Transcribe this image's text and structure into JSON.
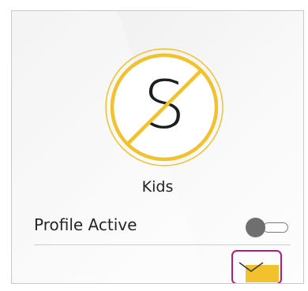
{
  "profile": {
    "name": "Kids",
    "initial": "S",
    "icon": "profile-disabled-icon",
    "ring_color": "#f2c12e",
    "accent": "#f2c12e"
  },
  "settings": {
    "active_label": "Profile Active",
    "active": false
  },
  "expand": {
    "icon": "chevron-down-icon",
    "highlight_color": "#b01e7a"
  }
}
